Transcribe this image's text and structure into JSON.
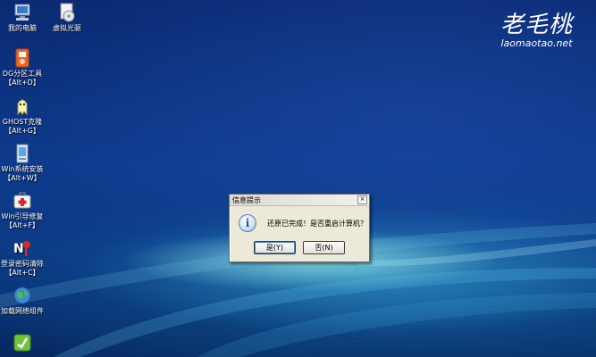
{
  "desktop": {
    "icons": [
      {
        "name": "computer",
        "label": "我的电脑",
        "label2": ""
      },
      {
        "name": "virtual-drive",
        "label": "虚拟光驱",
        "label2": ""
      },
      {
        "name": "dg-partition",
        "label": "DG分区工具",
        "label2": "【Alt+D】"
      },
      {
        "name": "ghost",
        "label": "GHOST克隆",
        "label2": "【Alt+G】"
      },
      {
        "name": "win-install",
        "label": "Win系统安装",
        "label2": "【Alt+W】"
      },
      {
        "name": "win-boot-repair",
        "label": "Win引导修复",
        "label2": "【Alt+F】"
      },
      {
        "name": "password-clear",
        "label": "登录密码清除",
        "label2": "【Alt+C】"
      },
      {
        "name": "network",
        "label": "加载网络组件",
        "label2": ""
      },
      {
        "name": "bottom-tool",
        "label": "",
        "label2": ""
      }
    ],
    "logo": {
      "cn": "老毛桃",
      "en": "laomaotao.net"
    }
  },
  "dialog": {
    "title": "信息提示",
    "close": "×",
    "icon_text": "i",
    "message": "还原已完成！是否重启计算机？",
    "yes_label": "是(Y)",
    "no_label": "否(N)"
  }
}
